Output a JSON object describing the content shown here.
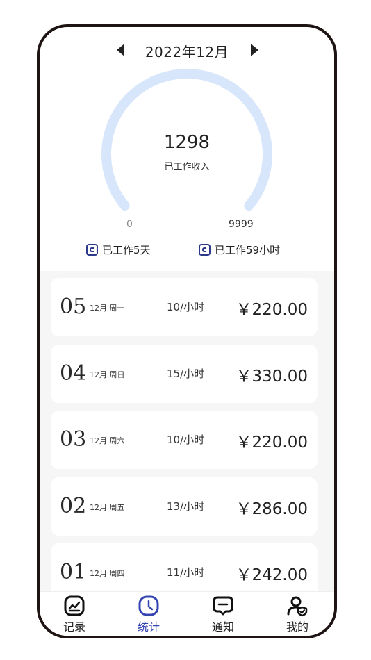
{
  "header": {
    "month_title": "2022年12月"
  },
  "gauge": {
    "total_value": "1298",
    "total_label": "已工作收入",
    "scale_min": "0",
    "scale_max": "9999",
    "track_color": "#d8e6fb"
  },
  "stats": {
    "days_label": "已工作5天",
    "hours_label": "已工作59小时",
    "icon": "wallet-icon",
    "icon_color": "#2d3a8c"
  },
  "records": [
    {
      "day": "05",
      "date": "12月 周一",
      "hours": "10/小时",
      "amount": "￥220.00"
    },
    {
      "day": "04",
      "date": "12月 周日",
      "hours": "15/小时",
      "amount": "￥330.00"
    },
    {
      "day": "03",
      "date": "12月 周六",
      "hours": "10/小时",
      "amount": "￥220.00"
    },
    {
      "day": "02",
      "date": "12月 周五",
      "hours": "13/小时",
      "amount": "￥286.00"
    },
    {
      "day": "01",
      "date": "12月 周四",
      "hours": "11/小时",
      "amount": "￥242.00"
    }
  ],
  "tabs": [
    {
      "label": "记录",
      "icon": "chart-icon",
      "active": false
    },
    {
      "label": "统计",
      "icon": "clock-icon",
      "active": true
    },
    {
      "label": "通知",
      "icon": "message-icon",
      "active": false
    },
    {
      "label": "我的",
      "icon": "user-shield-icon",
      "active": false
    }
  ],
  "colors": {
    "accent": "#3444b0",
    "list_background": "#f6f6f6"
  }
}
